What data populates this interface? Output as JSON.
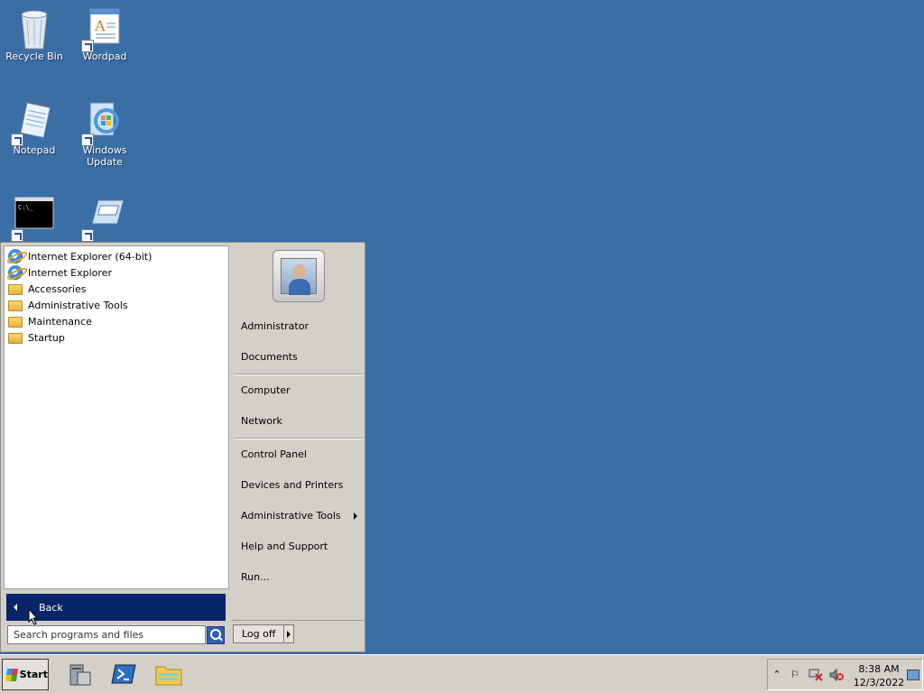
{
  "desktop": {
    "icons": [
      {
        "label": "Recycle Bin"
      },
      {
        "label": "Wordpad"
      },
      {
        "label": "Notepad"
      },
      {
        "label": "Windows Update"
      },
      {
        "label": ""
      },
      {
        "label": ""
      }
    ]
  },
  "start_menu": {
    "programs": [
      {
        "label": "Internet Explorer (64-bit)",
        "icon": "internet-explorer-icon"
      },
      {
        "label": "Internet Explorer",
        "icon": "internet-explorer-icon"
      },
      {
        "label": "Accessories",
        "icon": "folder-icon"
      },
      {
        "label": "Administrative Tools",
        "icon": "folder-icon"
      },
      {
        "label": "Maintenance",
        "icon": "folder-icon"
      },
      {
        "label": "Startup",
        "icon": "folder-icon"
      }
    ],
    "back_label": "Back",
    "search_placeholder": "Search programs and files",
    "right": {
      "user": "Administrator",
      "documents": "Documents",
      "computer": "Computer",
      "network": "Network",
      "control_panel": "Control Panel",
      "devices": "Devices and Printers",
      "admin_tools": "Administrative Tools",
      "help": "Help and Support",
      "run": "Run..."
    },
    "logoff_label": "Log off"
  },
  "taskbar": {
    "start_label": "Start",
    "clock_time": "8:38 AM",
    "clock_date": "12/3/2022"
  },
  "colors": {
    "desktop": "#3a6ea5",
    "selection": "#0a2469"
  }
}
